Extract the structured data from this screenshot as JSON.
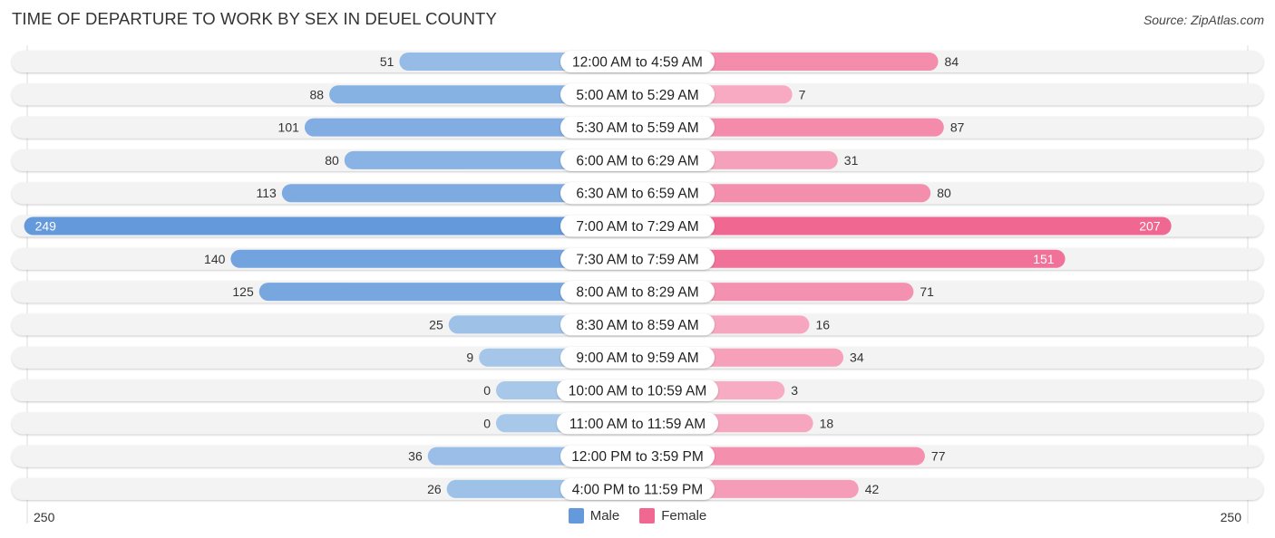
{
  "title": "TIME OF DEPARTURE TO WORK BY SEX IN DEUEL COUNTY",
  "source": "Source: ZipAtlas.com",
  "colors": {
    "male_strong": "#6499dc",
    "male_light": "#a8c8ea",
    "female_strong": "#f06791",
    "female_light": "#f7adc4",
    "track": "#f3f3f3",
    "label_bg": "#ffffff"
  },
  "chart_data": {
    "type": "bar",
    "orientation": "horizontal-diverging",
    "title": "TIME OF DEPARTURE TO WORK BY SEX IN DEUEL COUNTY",
    "categories": [
      "12:00 AM to 4:59 AM",
      "5:00 AM to 5:29 AM",
      "5:30 AM to 5:59 AM",
      "6:00 AM to 6:29 AM",
      "6:30 AM to 6:59 AM",
      "7:00 AM to 7:29 AM",
      "7:30 AM to 7:59 AM",
      "8:00 AM to 8:29 AM",
      "8:30 AM to 8:59 AM",
      "9:00 AM to 9:59 AM",
      "10:00 AM to 10:59 AM",
      "11:00 AM to 11:59 AM",
      "12:00 PM to 3:59 PM",
      "4:00 PM to 11:59 PM"
    ],
    "series": [
      {
        "name": "Male",
        "side": "left",
        "values": [
          51,
          88,
          101,
          80,
          113,
          249,
          140,
          125,
          25,
          9,
          0,
          0,
          36,
          26
        ]
      },
      {
        "name": "Female",
        "side": "right",
        "values": [
          84,
          7,
          87,
          31,
          80,
          207,
          151,
          71,
          16,
          34,
          3,
          18,
          77,
          42
        ]
      }
    ],
    "axis": {
      "left_label": "250",
      "right_label": "250",
      "max": 250
    },
    "legend": {
      "position": "bottom-center",
      "entries": [
        "Male",
        "Female"
      ]
    }
  }
}
